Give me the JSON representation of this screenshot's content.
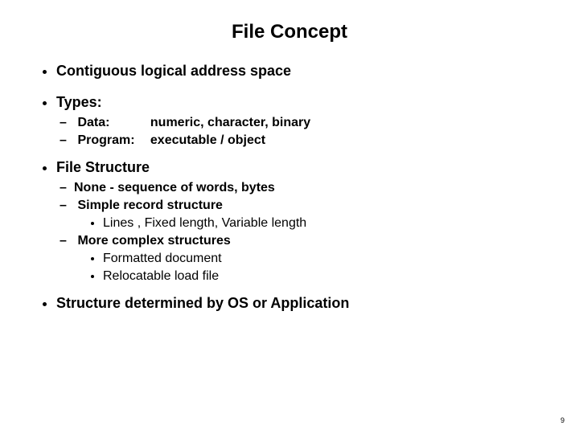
{
  "title": "File Concept",
  "bullets": {
    "b1": "Contiguous logical address space",
    "b2": "Types:",
    "types": {
      "data_key": "Data:",
      "data_val": "numeric, character, binary",
      "prog_key": "Program:",
      "prog_val": "executable / object"
    },
    "b3": "File Structure",
    "fs": {
      "none": "None - sequence of words, bytes",
      "simple": "Simple record structure",
      "simple_sub": "Lines , Fixed length, Variable length",
      "complex": "More complex structures",
      "complex_s1": "Formatted document",
      "complex_s2": "Relocatable load file"
    },
    "b4": "Structure determined by OS or Application"
  },
  "page_number": "9"
}
